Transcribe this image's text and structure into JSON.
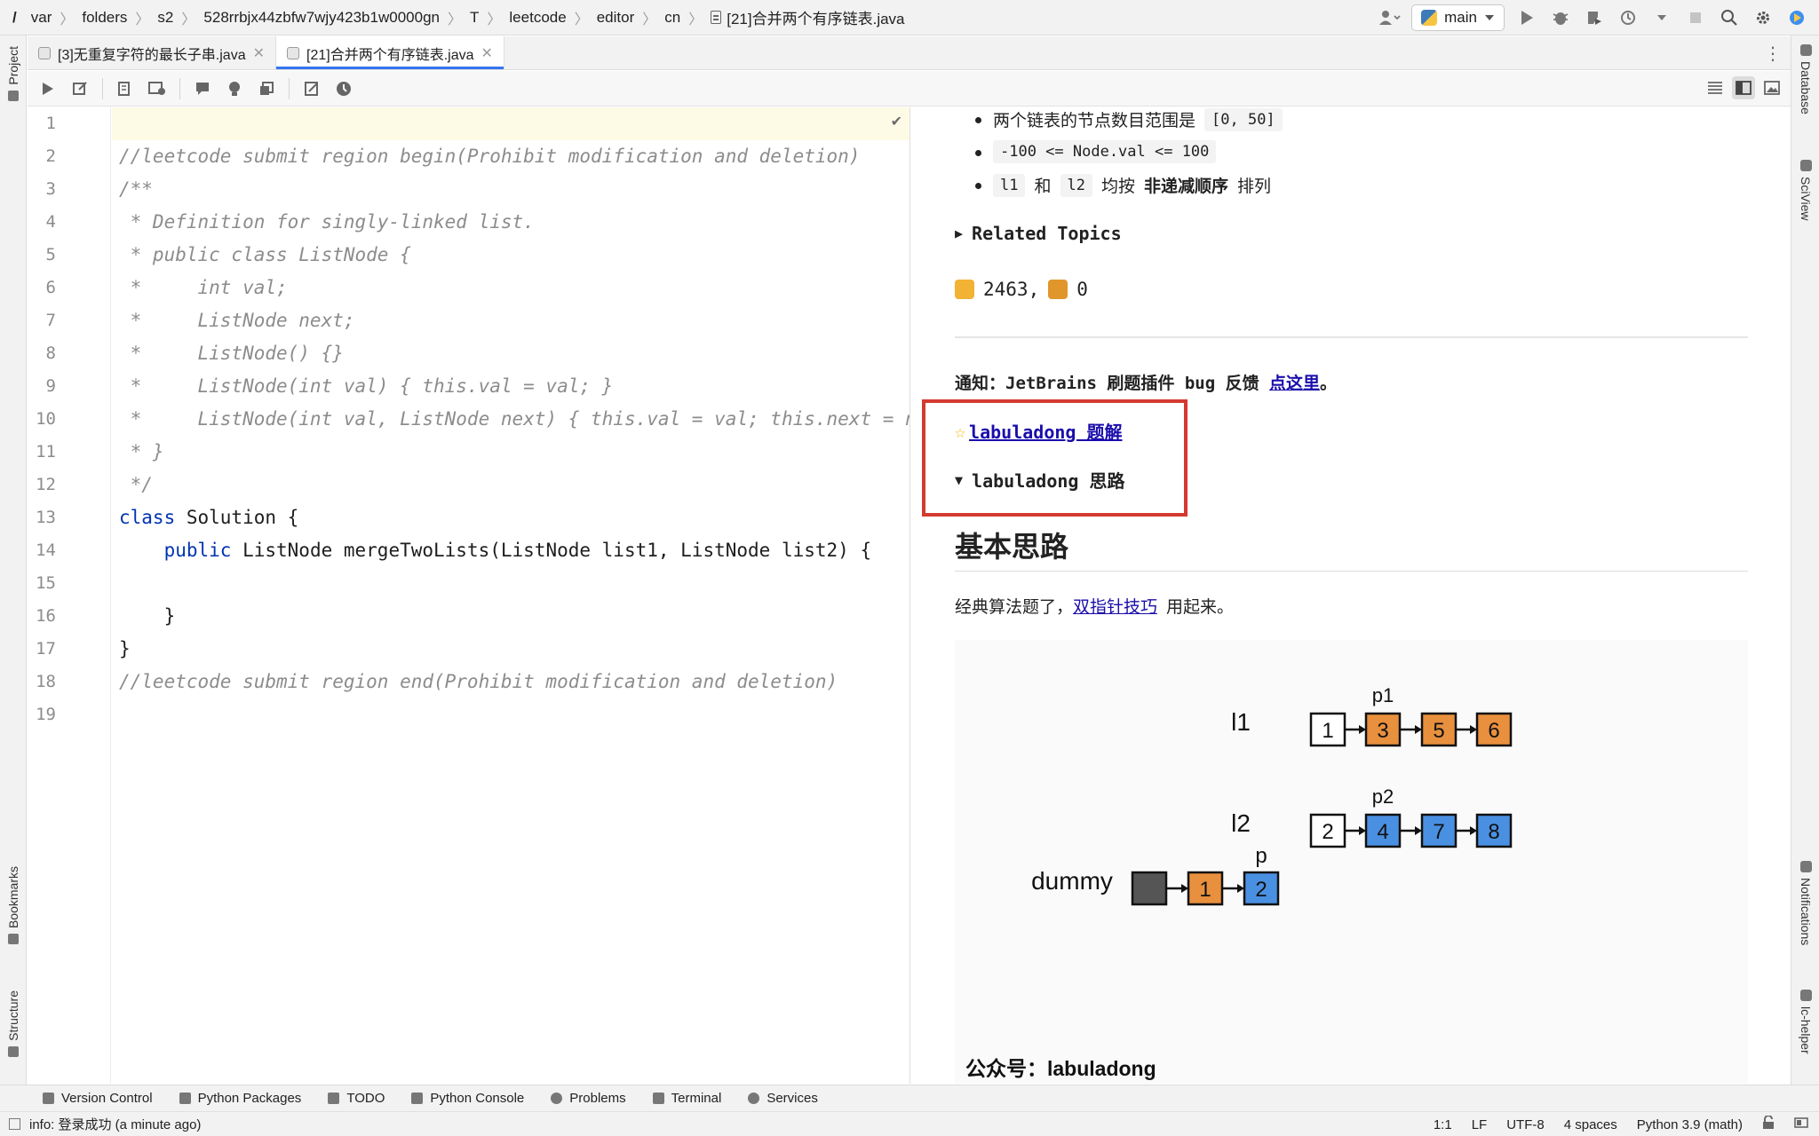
{
  "breadcrumb": {
    "root": "/",
    "items": [
      "var",
      "folders",
      "s2",
      "528rrbjx44zbfw7wjy423b1w0000gn",
      "T",
      "leetcode",
      "editor",
      "cn",
      "[21]合并两个有序链表.java"
    ]
  },
  "toolbar": {
    "run_config": "main",
    "icons": [
      "user-icon",
      "run-icon",
      "debug-icon",
      "coverage-icon",
      "profile-icon",
      "stop-icon",
      "search-icon",
      "settings-icon",
      "plugin-icon"
    ]
  },
  "left_strip": {
    "top": "Project",
    "bottom1": "Bookmarks",
    "bottom2": "Structure"
  },
  "right_strip": {
    "top1": "Database",
    "top2": "SciView",
    "bottom1": "Notifications",
    "bottom2": "lc-helper"
  },
  "tabs": [
    {
      "label": "[3]无重复字符的最长子串.java",
      "active": false
    },
    {
      "label": "[21]合并两个有序链表.java",
      "active": true
    }
  ],
  "editor": {
    "line_numbers": [
      "1",
      "2",
      "3",
      "4",
      "5",
      "6",
      "7",
      "8",
      "9",
      "10",
      "11",
      "12",
      "13",
      "14",
      "15",
      "16",
      "17",
      "18",
      "19"
    ],
    "lines": [
      "",
      "//leetcode submit region begin(Prohibit modification and deletion)",
      "/**",
      " * Definition for singly-linked list.",
      " * public class ListNode {",
      " *     int val;",
      " *     ListNode next;",
      " *     ListNode() {}",
      " *     ListNode(int val) { this.val = val; }",
      " *     ListNode(int val, ListNode next) { this.val = val; this.next = next; }",
      " * }",
      " */",
      "class Solution {",
      "    public ListNode mergeTwoLists(ListNode list1, ListNode list2) {",
      "",
      "    }",
      "}",
      "//leetcode submit region end(Prohibit modification and deletion)",
      ""
    ],
    "line13_kw": "class",
    "line13_rest": " Solution {",
    "line14_indent": "    ",
    "line14_kw": "public",
    "line14_rest": " ListNode mergeTwoLists(ListNode list1, ListNode list2) {"
  },
  "preview": {
    "bullet1_text": "两个链表的节点数目范围是",
    "bullet1_code": "[0, 50]",
    "bullet2_code": "-100 <= Node.val <= 100",
    "bullet3_code1": "l1",
    "bullet3_and": "和",
    "bullet3_code2": "l2",
    "bullet3_text1": "均按",
    "bullet3_bold": "非递减顺序",
    "bullet3_text2": "排列",
    "related_topics": "Related Topics",
    "likes": "2463,",
    "dislikes": "0",
    "notice_text": "通知：JetBrains 刷题插件 bug 反馈",
    "notice_link": "点这里",
    "notice_end": "。",
    "solution_link": "labuladong 题解",
    "idea_summary": "labuladong 思路",
    "heading": "基本思路",
    "para_before": "经典算法题了，",
    "para_link": "双指针技巧",
    "para_after": "用起来。",
    "diagram": {
      "row_labels": [
        "l1",
        "l2",
        "dummy"
      ],
      "pointer_labels": [
        "p1",
        "p2",
        "p"
      ],
      "l1_nodes": [
        "1",
        "3",
        "5",
        "6"
      ],
      "l2_nodes": [
        "2",
        "4",
        "7",
        "8"
      ],
      "dummy_nodes": [
        "",
        "1",
        "2"
      ],
      "wechat": "公众号：labuladong"
    }
  },
  "tool_windows": [
    "Version Control",
    "Python Packages",
    "TODO",
    "Python Console",
    "Problems",
    "Terminal",
    "Services"
  ],
  "status": {
    "message": "info: 登录成功 (a minute ago)",
    "position": "1:1",
    "line_sep": "LF",
    "encoding": "UTF-8",
    "indent": "4 spaces",
    "interpreter": "Python 3.9 (math)"
  },
  "colors": {
    "accent": "#3574f0",
    "keyword": "#0033b3",
    "comment": "#8c8c8c",
    "highlight_box": "#d43a2f",
    "node_orange": "#e8903e",
    "node_blue": "#4a90e2",
    "link": "#1a0dab"
  }
}
